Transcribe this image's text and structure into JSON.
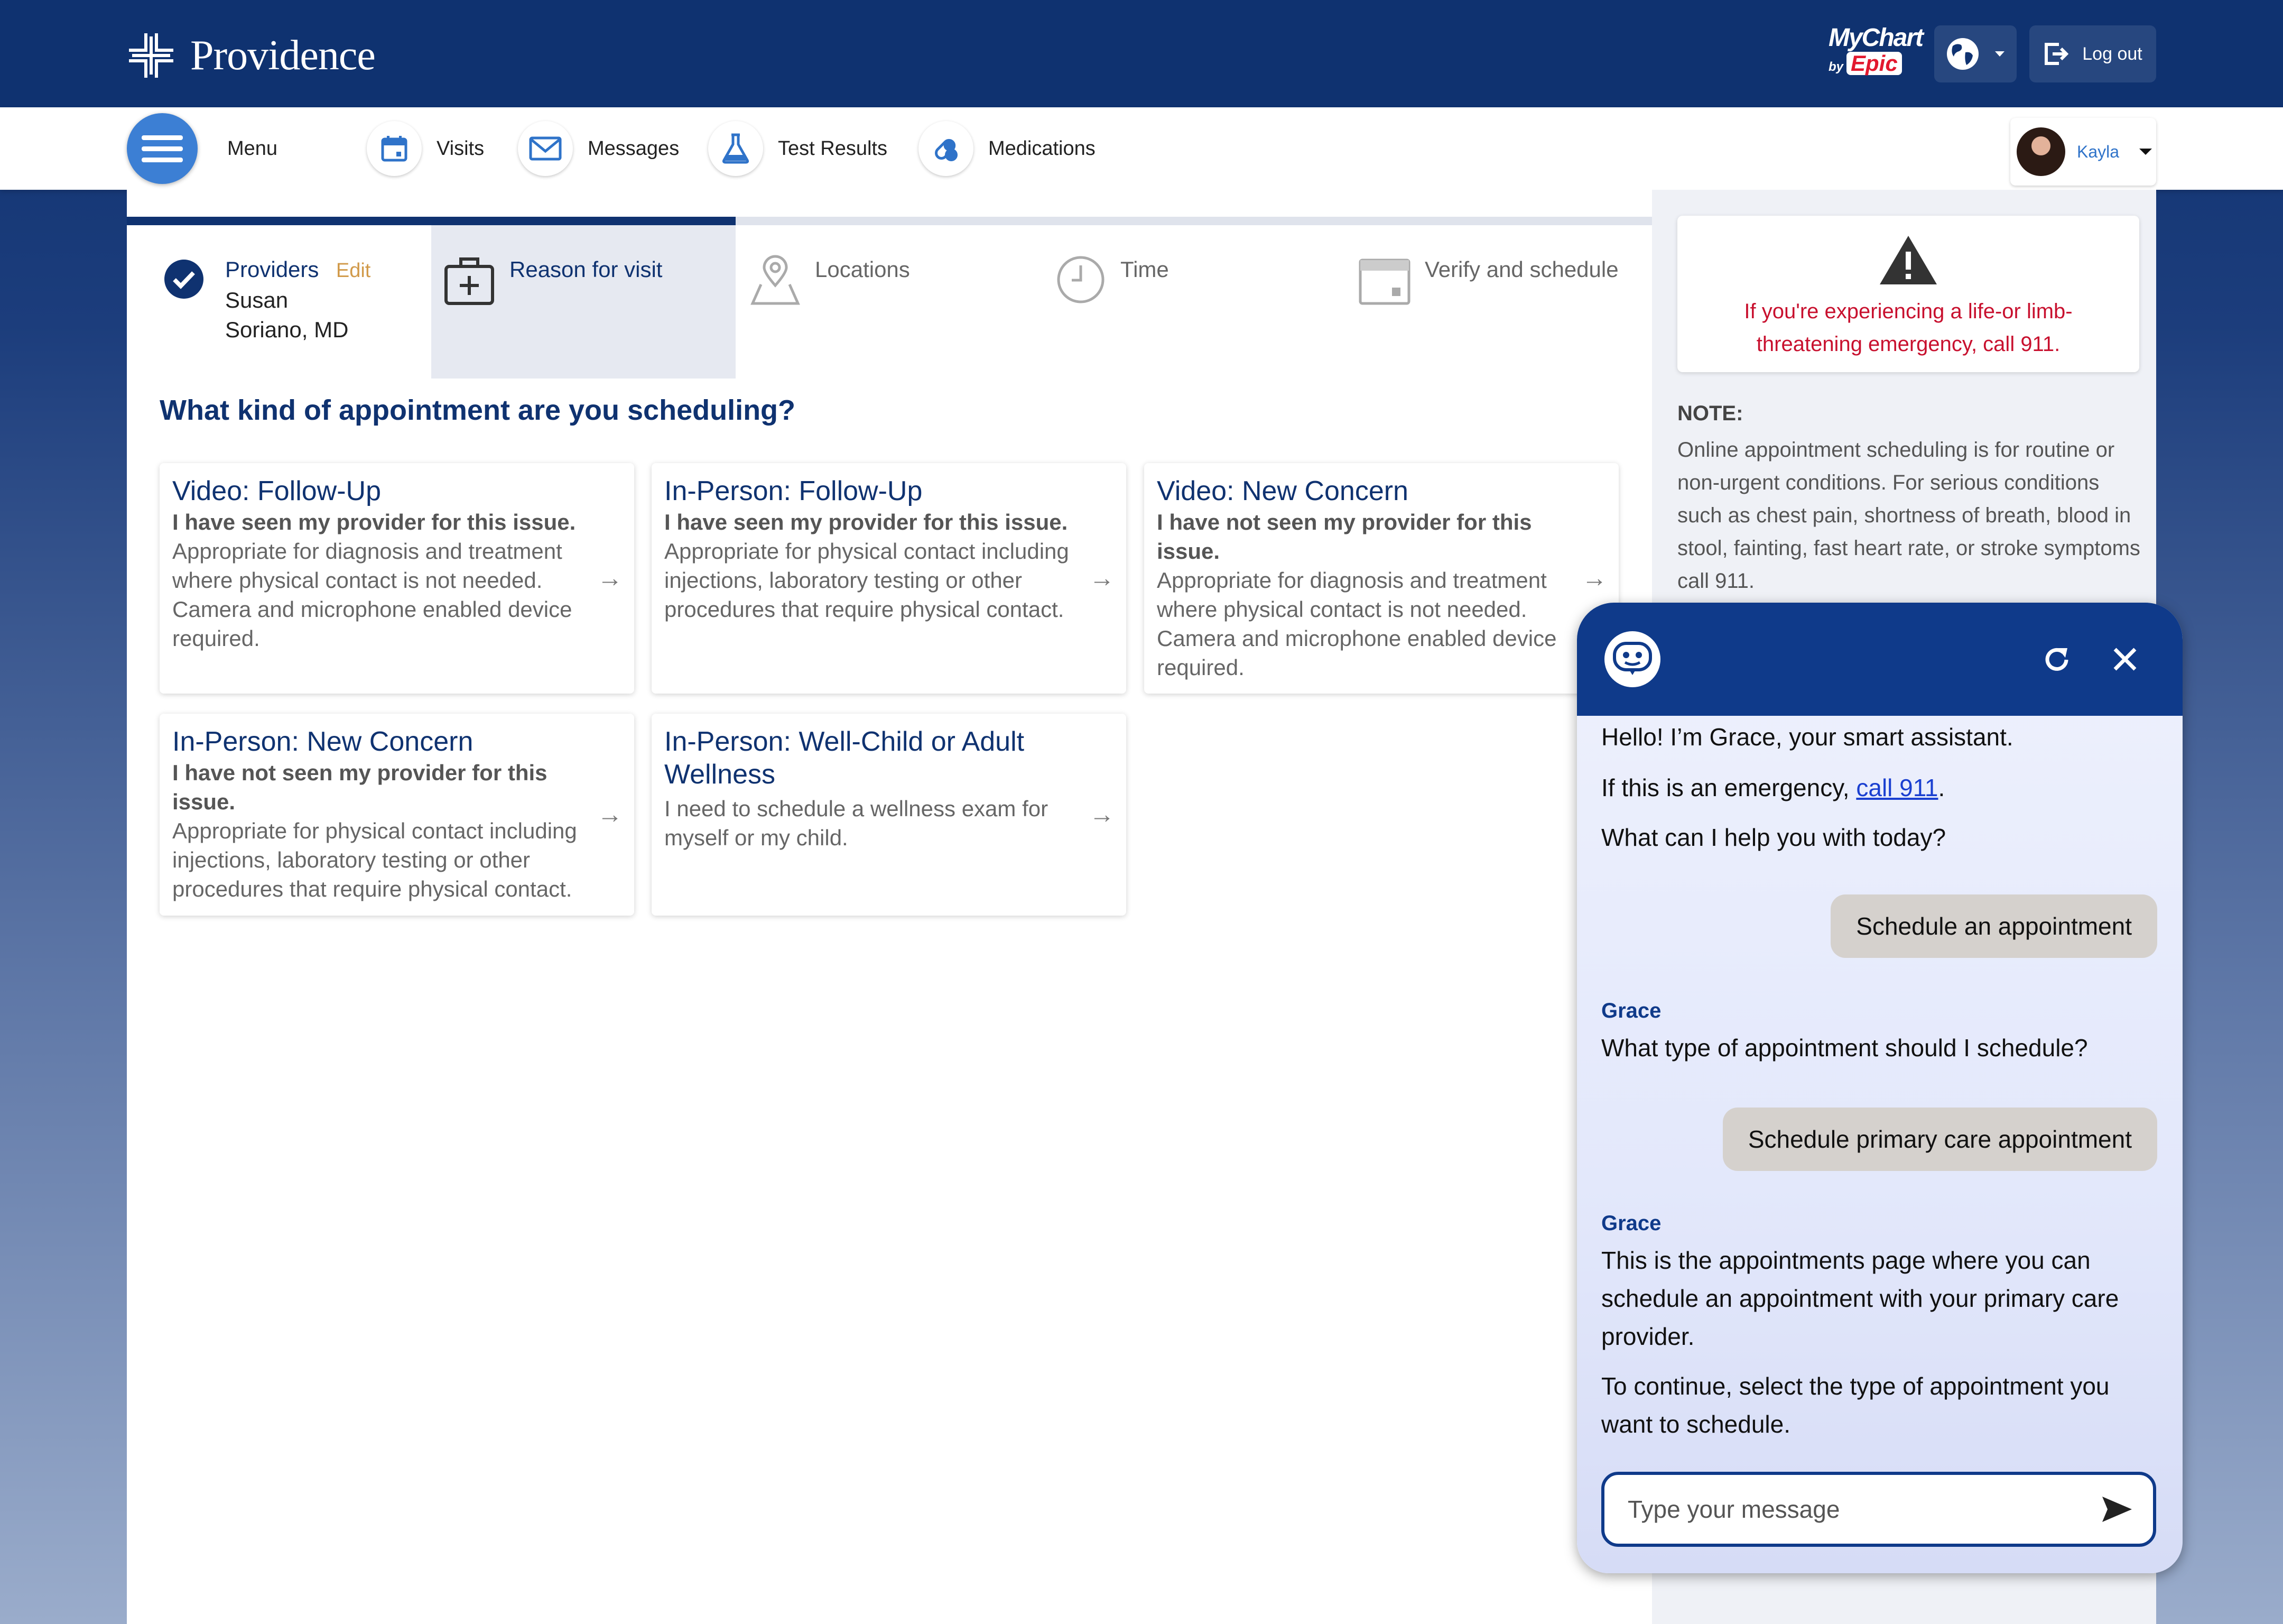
{
  "header": {
    "brand": "Providence",
    "mychart_label": "MyChart",
    "mychart_by": "by",
    "mychart_epic": "Epic",
    "logout_label": "Log out"
  },
  "nav": {
    "menu_label": "Menu",
    "items": [
      {
        "label": "Visits",
        "icon": "calendar-icon"
      },
      {
        "label": "Messages",
        "icon": "envelope-icon"
      },
      {
        "label": "Test Results",
        "icon": "flask-icon"
      },
      {
        "label": "Medications",
        "icon": "pills-icon"
      }
    ],
    "user_name": "Kayla"
  },
  "steps": [
    {
      "label": "Providers",
      "edit_label": "Edit",
      "value_line1": "Susan",
      "value_line2": "Soriano, MD",
      "state": "done"
    },
    {
      "label": "Reason for visit",
      "state": "active"
    },
    {
      "label": "Locations",
      "state": "pending"
    },
    {
      "label": "Time",
      "state": "pending"
    },
    {
      "label": "Verify and schedule",
      "state": "pending"
    }
  ],
  "question": "What kind of appointment are you scheduling?",
  "cards": [
    {
      "title": "Video: Follow-Up",
      "bold": "I have seen my provider for this issue.",
      "desc": "Appropriate for diagnosis and treatment where physical contact is not needed. Camera and microphone enabled device required."
    },
    {
      "title": "In-Person: Follow-Up",
      "bold": "I have seen my provider for this issue.",
      "desc": "Appropriate for physical contact including injections, laboratory testing or other procedures that require physical contact."
    },
    {
      "title": "Video: New Concern",
      "bold": "I have not seen my provider for this issue.",
      "desc": "Appropriate for diagnosis and treatment where physical contact is not needed. Camera and microphone enabled device required."
    },
    {
      "title": "In-Person: New Concern",
      "bold": "I have not seen my provider for this issue.",
      "desc": "Appropriate for physical contact including injections, laboratory testing or other procedures that require physical contact."
    },
    {
      "title": "In-Person: Well-Child or Adult Wellness",
      "bold": "",
      "desc": "I need to schedule a wellness exam for myself or my child."
    }
  ],
  "sidebar": {
    "emergency": "If you're experiencing a life-or limb-threatening emergency, call 911.",
    "note_head": "NOTE:",
    "note_text": "Online appointment scheduling is for routine or non-urgent conditions. For serious conditions such as chest pain, shortness of breath, blood in stool, fainting, fast heart rate, or stroke symptoms call 911."
  },
  "chat": {
    "greeting": "Hello! I’m Grace, your smart assistant.",
    "emergency_prefix": "If this is an emergency, ",
    "emergency_link": "call 911",
    "emergency_suffix": ".",
    "help_prompt": "What can I help you with today?",
    "user_msg_1": "Schedule an appointment",
    "bot_name": "Grace",
    "bot_msg_1": "What type of appointment should I schedule?",
    "user_msg_2": "Schedule primary care appointment",
    "bot_msg_2a": "This is the appointments page where you can schedule an appointment with your primary care provider.",
    "bot_msg_2b": "To continue, select the type of appointment you want to schedule.",
    "input_placeholder": "Type your message"
  },
  "colors": {
    "brand_navy": "#0f3270",
    "link_blue": "#2f73c9",
    "emergency_red": "#c8102e",
    "edit_gold": "#d19a4a"
  }
}
